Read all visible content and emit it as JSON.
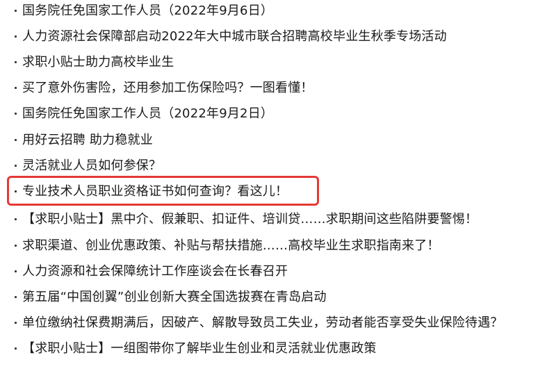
{
  "news": {
    "items": [
      {
        "title": "国务院任免国家工作人员（2022年9月6日）"
      },
      {
        "title": "人力资源社会保障部启动2022年大中城市联合招聘高校毕业生秋季专场活动"
      },
      {
        "title": "求职小贴士助力高校毕业生"
      },
      {
        "title": "买了意外伤害险，还用参加工伤保险吗？一图看懂！"
      },
      {
        "title": "国务院任免国家工作人员（2022年9月2日）"
      },
      {
        "title": "用好云招聘 助力稳就业"
      },
      {
        "title": "灵活就业人员如何参保？"
      },
      {
        "title": "专业技术人员职业资格证书如何查询？看这儿！"
      },
      {
        "title": "【求职小贴士】黑中介、假兼职、扣证件、培训贷……求职期间这些陷阱要警惕！"
      },
      {
        "title": "求职渠道、创业优惠政策、补贴与帮扶措施……高校毕业生求职指南来了！"
      },
      {
        "title": "人力资源和社会保障统计工作座谈会在长春召开"
      },
      {
        "title": "第五届“中国创翼”创业创新大赛全国选拔赛在青岛启动"
      },
      {
        "title": "单位缴纳社保费期满后，因破产、解散导致员工失业，劳动者能否享受失业保险待遇？"
      },
      {
        "title": "【求职小贴士】一组图带你了解毕业生创业和灵活就业优惠政策"
      }
    ]
  },
  "highlight": {
    "color": "#e53935",
    "item_index": 7
  }
}
